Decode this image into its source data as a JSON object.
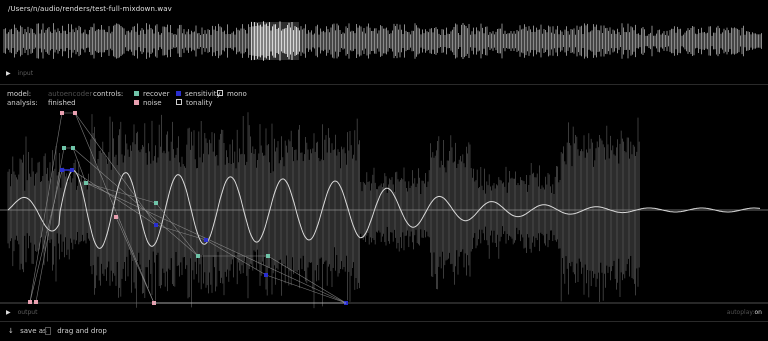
{
  "file": {
    "path": "/Users/n/audio/renders/test-full-mixdown.wav"
  },
  "overview": {
    "toggle_label": "input",
    "toggle_icon": "play-icon"
  },
  "info": {
    "model_label": "model:",
    "model_value": "autoencoder",
    "analysis_label": "analysis:",
    "analysis_value": "finished",
    "controls_label": "controls:"
  },
  "controls": [
    {
      "label": "recover",
      "color": "#6fc4a8",
      "style": "fill"
    },
    {
      "label": "sensitivity",
      "color": "#2a2fd0",
      "style": "fill"
    },
    {
      "label": "mono",
      "color": "#cfcfcf",
      "style": "outline"
    },
    {
      "label": "noise",
      "color": "#e8a0b0",
      "style": "fill"
    },
    {
      "label": "tonality",
      "color": "#cfcfcf",
      "style": "outline"
    }
  ],
  "output": {
    "toggle_label": "output",
    "toggle_icon": "play-icon",
    "mode_dim": "autoplay:",
    "mode_value": "on"
  },
  "footer": {
    "save_icon": "download-icon",
    "save_label": "save as",
    "drop_icon": "document-icon",
    "drop_label": "drag and drop"
  },
  "colors": {
    "recover": "#6fc4a8",
    "noise": "#e8a0b0",
    "sensitivity": "#2a2fd0",
    "outline": "#cfcfcf"
  }
}
